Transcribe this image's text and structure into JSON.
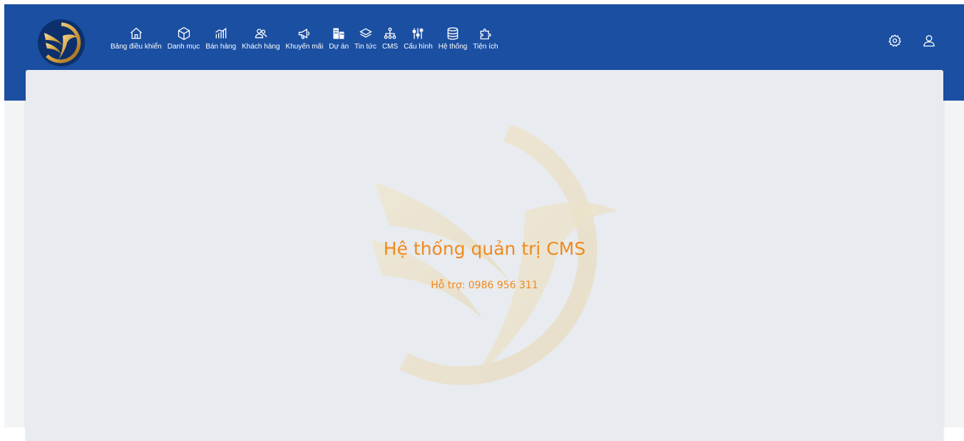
{
  "header": {
    "nav": [
      {
        "label": "Bảng điều khiển",
        "icon": "home-icon"
      },
      {
        "label": "Danh mục",
        "icon": "box-icon"
      },
      {
        "label": "Bán hàng",
        "icon": "chart-icon"
      },
      {
        "label": "Khách hàng",
        "icon": "users-icon"
      },
      {
        "label": "Khuyến mãi",
        "icon": "megaphone-icon"
      },
      {
        "label": "Dự án",
        "icon": "building-icon"
      },
      {
        "label": "Tin tức",
        "icon": "layers-icon"
      },
      {
        "label": "CMS",
        "icon": "sitemap-icon"
      },
      {
        "label": "Cấu hình",
        "icon": "sliders-icon"
      },
      {
        "label": "Hệ thống",
        "icon": "database-icon"
      },
      {
        "label": "Tiện ích",
        "icon": "puzzle-icon"
      }
    ],
    "right_icons": [
      "settings-icon",
      "user-icon"
    ]
  },
  "main": {
    "title": "Hệ thống quản trị CMS",
    "support": "Hỗ trợ: 0986 956 311"
  },
  "colors": {
    "header_bg": "#1a4fa2",
    "card_bg": "#e8ebef",
    "accent": "#f08a1d"
  }
}
